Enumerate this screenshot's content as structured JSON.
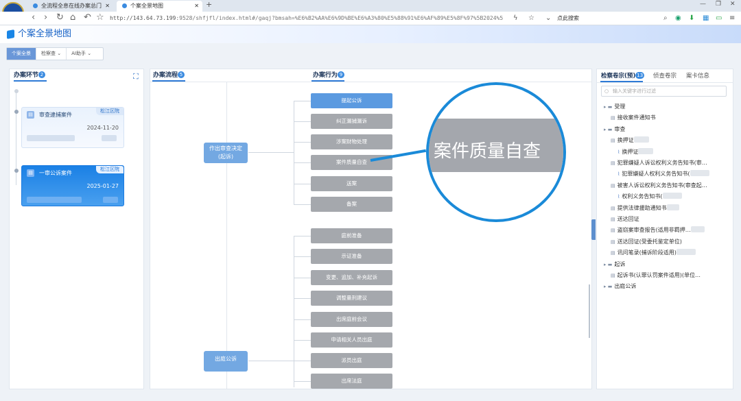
{
  "browser": {
    "tabs": [
      {
        "label": "全流程全息在线办案总门"
      },
      {
        "label": "个案全景地图"
      }
    ],
    "url_prefix": "http://143.64.73.199",
    "url_rest": ":9528/shfjfl/index.html#/gaqj?bmsah=%E6%B2%AA%E6%9D%BE%E6%A3%80%E5%88%91%E6%AF%89%E5%8F%97%5B2024%5",
    "search_placeholder": "点此搜索"
  },
  "app": {
    "title": "个案全景地图",
    "subtabs": [
      "个案全景",
      "检察查",
      "AI助手"
    ]
  },
  "left": {
    "title": "办案环节",
    "count": "2",
    "cases": [
      {
        "title": "审查逮捕案件",
        "court": "松江区院",
        "date": "2024-11-20",
        "selected": false
      },
      {
        "title": "一审公诉案件",
        "court": "松江区院",
        "date": "2025-01-27",
        "selected": true
      }
    ]
  },
  "middle": {
    "flow_title": "办案流程",
    "flow_count": "5",
    "action_title": "办案行为",
    "action_count": "9",
    "stage1": {
      "line1": "作出审查决定",
      "line2": "(起诉)"
    },
    "stage2": {
      "label": "出庭公诉"
    },
    "actions1": [
      "提起公诉",
      "纠正漏捕漏诉",
      "涉案财物处理",
      "案件质量自查",
      "送案",
      "备案"
    ],
    "actions2": [
      "庭前准备",
      "示证准备",
      "变更、追加、补充起诉",
      "调整量刑建议",
      "出席庭前会议",
      "申请相关人员出庭",
      "派员出庭",
      "出席法庭"
    ],
    "magnifier_text": "案件质量自查"
  },
  "right": {
    "tabs": [
      "检察卷宗(预)",
      "侦查卷宗",
      "案卡信息"
    ],
    "tab_count": "13",
    "search_placeholder": "输入关键字进行过滤",
    "tree": [
      {
        "level": 0,
        "type": "folder",
        "label": "受理"
      },
      {
        "level": 1,
        "type": "doc",
        "label": "接收案件通知书"
      },
      {
        "level": 0,
        "type": "folder",
        "label": "审查"
      },
      {
        "level": 1,
        "type": "doc",
        "label": "换押证"
      },
      {
        "level": 2,
        "type": "clip",
        "label": "换押证"
      },
      {
        "level": 1,
        "type": "doc",
        "label": "犯罪嫌疑人诉讼权利义务告知书(审…"
      },
      {
        "level": 2,
        "type": "clip",
        "label": "犯罪嫌疑人权利义务告知书("
      },
      {
        "level": 1,
        "type": "doc",
        "label": "被害人诉讼权利义务告知书(审查起…"
      },
      {
        "level": 2,
        "type": "clip",
        "label": "权利义务告知书("
      },
      {
        "level": 1,
        "type": "doc",
        "label": "提供法律援助通知书"
      },
      {
        "level": 1,
        "type": "doc",
        "label": "送达回证"
      },
      {
        "level": 1,
        "type": "doc",
        "label": "盗窃案审查报告(适用非羁押…"
      },
      {
        "level": 1,
        "type": "doc",
        "label": "送达回证(受委托鉴定单位)"
      },
      {
        "level": 1,
        "type": "doc",
        "label": "讯问笔录(捕诉阶段适用)"
      },
      {
        "level": 0,
        "type": "folder",
        "label": "起诉"
      },
      {
        "level": 1,
        "type": "doc",
        "label": "起诉书(认罪认罚案件适用)(单位…"
      },
      {
        "level": 0,
        "type": "folder",
        "label": "出庭公诉"
      }
    ]
  }
}
